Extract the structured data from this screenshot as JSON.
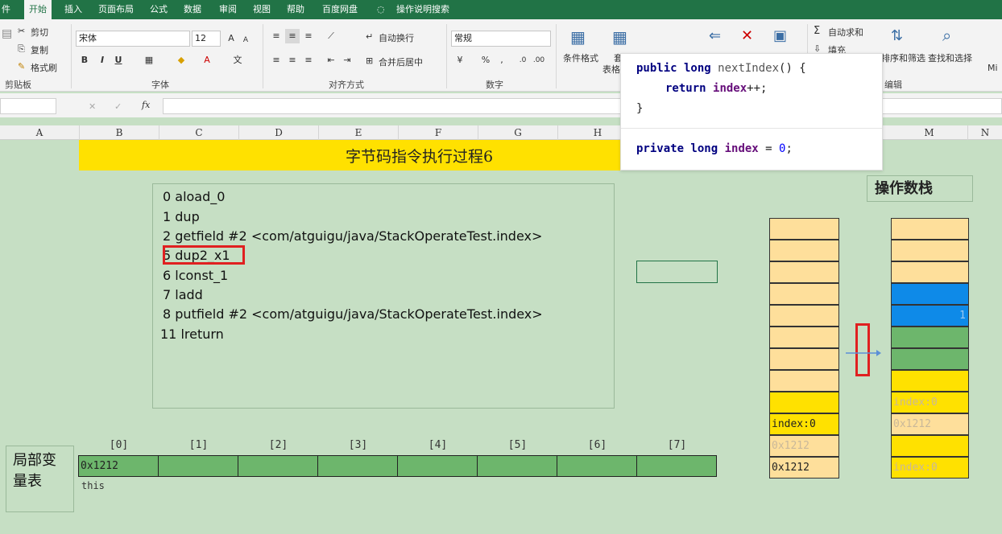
{
  "ribbon_tabs": [
    "件",
    "开始",
    "插入",
    "页面布局",
    "公式",
    "数据",
    "审阅",
    "视图",
    "帮助",
    "百度网盘",
    "操作说明搜索"
  ],
  "clipboard": {
    "cut": "剪切",
    "copy": "复制",
    "format_painter": "格式刷",
    "label": "剪贴板"
  },
  "font": {
    "name": "宋体",
    "size": "12",
    "label": "字体",
    "bold": "B",
    "italic": "I",
    "underline": "U",
    "grow": "A",
    "shrink": "A"
  },
  "alignment": {
    "wrap": "自动换行",
    "merge": "合并后居中",
    "label": "对齐方式"
  },
  "number": {
    "format": "常规",
    "label": "数字",
    "percent": "%",
    "comma": ","
  },
  "styles": {
    "conditional": "条件格式",
    "table": "套用",
    "table2": "表格"
  },
  "editing": {
    "autosum": "自动求和",
    "fill": "填充",
    "sort": "排序和筛选",
    "find": "查找和选择",
    "label": "编辑",
    "extra": "Mi"
  },
  "formula_bar": {
    "fx": "fx",
    "cancel": "✕",
    "enter": "✓"
  },
  "columns": [
    "A",
    "B",
    "C",
    "D",
    "E",
    "F",
    "G",
    "H",
    "M",
    "N"
  ],
  "popup": {
    "line1_kw": "public long",
    "line1_fn": "nextIndex",
    "line1_rest": "() {",
    "line2_kw": "return",
    "line2_field": "index",
    "line2_rest": "++;",
    "line3": "}",
    "line4_kw": "private long",
    "line4_field": "index",
    "line4_rest": " = ",
    "line4_num": "0",
    "line4_end": ";"
  },
  "title": "字节码指令执行过程6",
  "bytecode": [
    "0 aload_0",
    "1 dup",
    "2 getfield #2 <com/atguigu/java/StackOperateTest.index>",
    "5 dup2_x1",
    "6 lconst_1",
    "7 ladd",
    "8 putfield #2 <com/atguigu/java/StackOperateTest.index>",
    "11 lreturn"
  ],
  "stack_title": "操作数栈",
  "left_stack": [
    "",
    "",
    "",
    "",
    "",
    "",
    "",
    "",
    "",
    "index:0",
    "0x1212",
    "0x1212"
  ],
  "right_stack": [
    "",
    "",
    "",
    "",
    "1",
    "",
    "",
    "",
    "index:0",
    "0x1212",
    "",
    "index:0"
  ],
  "local_vars": {
    "label": "局部变量表",
    "indices": [
      "[0]",
      "[1]",
      "[2]",
      "[3]",
      "[4]",
      "[5]",
      "[6]",
      "[7]"
    ],
    "values": [
      "0x1212",
      "",
      "",
      "",
      "",
      "",
      "",
      ""
    ],
    "slot0_name": "this"
  }
}
